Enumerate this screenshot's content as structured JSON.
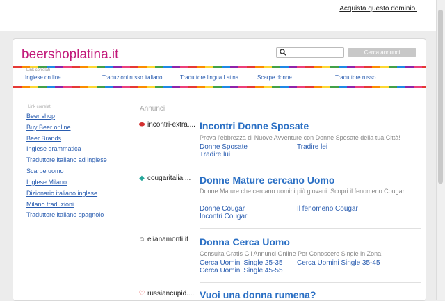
{
  "topbar": {
    "buy_domain": "Acquista questo dominio."
  },
  "header": {
    "logo": "beershoplatina.it",
    "search_placeholder": "",
    "search_button": "Cerca annunci"
  },
  "top_links": {
    "label": "Link correlati",
    "items": [
      "Inglese on line",
      "Traduzioni russo italiano",
      "Traduttore lingua Latina",
      "Scarpe donne",
      "Traduttore russo"
    ]
  },
  "sidebar": {
    "label": "Link correlati",
    "items": [
      "Beer shop",
      "Buy Beer online",
      "Beer Brands",
      "Inglese grammatica",
      "Traduttore italiano ad inglese",
      "Scarpe uomo",
      "Inglese Milano",
      "Dizionario italiano inglese",
      "Milano traduzioni",
      "Traduttore italiano spagnolo"
    ]
  },
  "ads": {
    "label": "Annunci",
    "items": [
      {
        "source": "incontri-extra....",
        "source_icon": "lips-icon",
        "title": "Incontri Donne Sposate",
        "desc": "Prova l'ebbrezza di Nuove Avventure con Donne Sposate della tua Città!",
        "links": [
          "Donne Sposate",
          "Tradire lei",
          "Tradire lui"
        ]
      },
      {
        "source": "cougaritalia....",
        "source_icon": "diamond-icon",
        "title": "Donne Mature cercano Uomo",
        "desc": "Donne Mature che cercano uomini più giovani. Scopri il fenomeno Cougar.",
        "links": [
          "Donne Cougar",
          "Il fenomeno Cougar",
          "Incontri Cougar"
        ]
      },
      {
        "source": "elianamonti.it",
        "source_icon": "people-icon",
        "title": "Donna Cerca Uomo",
        "desc": "Consulta Gratis Gli Annunci Online Per Conoscere Single in Zona!",
        "links": [
          "Cerca Uomini Single 25-35",
          "Cerca Uomini Single 35-45",
          "Cerca Uomini Single 45-55"
        ]
      },
      {
        "source": "russiancupid....",
        "source_icon": "heart-icon",
        "title": "Vuoi una donna rumena?",
        "desc": "",
        "links": []
      }
    ]
  },
  "colors": {
    "logo": "#c2187a",
    "link": "#2a5db0",
    "ad_title": "#2a6fc4"
  }
}
